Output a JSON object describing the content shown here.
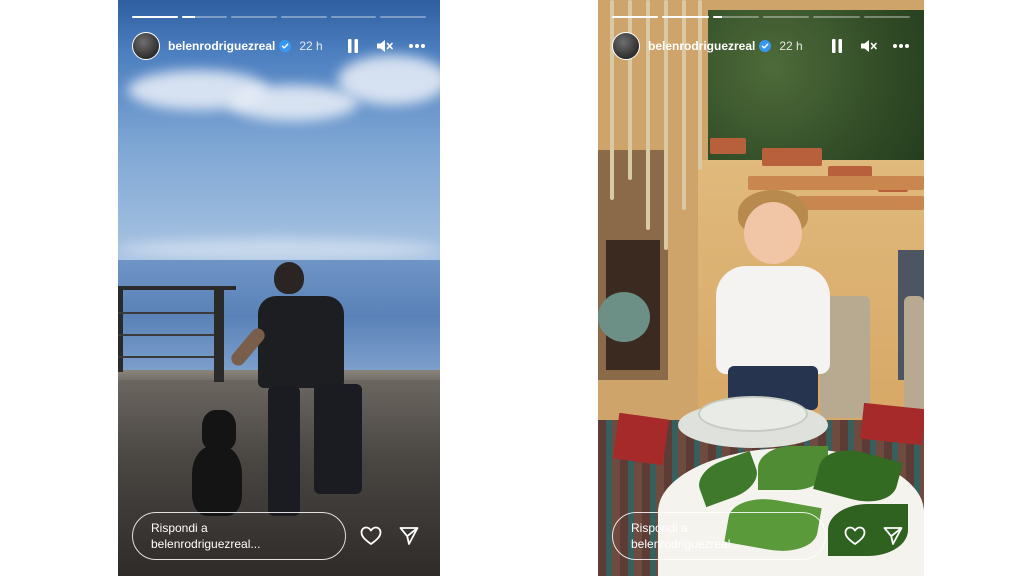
{
  "stories": [
    {
      "username": "belenrodriguezreal",
      "time": "22 h",
      "progress": [
        1,
        0.3,
        0,
        0,
        0,
        0
      ],
      "reply_line1": "Rispondi a",
      "reply_line2": "belenrodriguezreal...",
      "controls": [
        "pause-icon",
        "mute-icon",
        "more-icon"
      ],
      "actions": [
        "heart-icon",
        "share-icon"
      ]
    },
    {
      "username": "belenrodriguezreal",
      "time": "22 h",
      "progress": [
        1,
        1,
        0.2,
        0,
        0,
        0
      ],
      "reply_line1": "Rispondi a",
      "reply_line2": "belenrodriguezreal...",
      "controls": [
        "pause-icon",
        "mute-icon",
        "more-icon"
      ],
      "actions": [
        "heart-icon",
        "share-icon"
      ]
    }
  ],
  "colors": {
    "page_background": "#ffffff",
    "overlay_text": "#ffffff",
    "verified_badge": "#3897f0"
  }
}
